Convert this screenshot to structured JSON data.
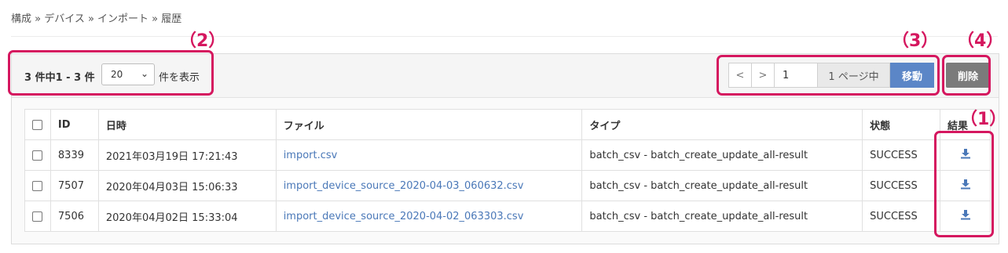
{
  "breadcrumb": "構成 » デバイス » インポート » 履歴",
  "list_header": {
    "count_text": "3 件中1 - 3 件",
    "per_page_value": "20",
    "per_page_suffix": "件を表示"
  },
  "pager": {
    "prev": "<",
    "next": ">",
    "page_value": "1",
    "total_pages_text": "1 ページ中",
    "go_label": "移動"
  },
  "delete_label": "削除",
  "table": {
    "columns": [
      "ID",
      "日時",
      "ファイル",
      "タイプ",
      "状態",
      "結果"
    ],
    "rows": [
      {
        "id": "8339",
        "datetime": "2021年03月19日 17:21:43",
        "file": "import.csv",
        "type": "batch_csv - batch_create_update_all-result",
        "status": "SUCCESS"
      },
      {
        "id": "7507",
        "datetime": "2020年04月03日 15:06:33",
        "file": "import_device_source_2020-04-03_060632.csv",
        "type": "batch_csv - batch_create_update_all-result",
        "status": "SUCCESS"
      },
      {
        "id": "7506",
        "datetime": "2020年04月02日 15:33:04",
        "file": "import_device_source_2020-04-02_063303.csv",
        "type": "batch_csv - batch_create_update_all-result",
        "status": "SUCCESS"
      }
    ]
  },
  "annotations": {
    "a1": "（1）",
    "a2": "（2）",
    "a3": "（3）",
    "a4": "（4）"
  },
  "colors": {
    "highlight": "#d5175f",
    "link": "#4a78b8",
    "go_button": "#5b86c7",
    "delete_button": "#7b7b7b"
  },
  "icons": {
    "result_download": "download-icon"
  }
}
